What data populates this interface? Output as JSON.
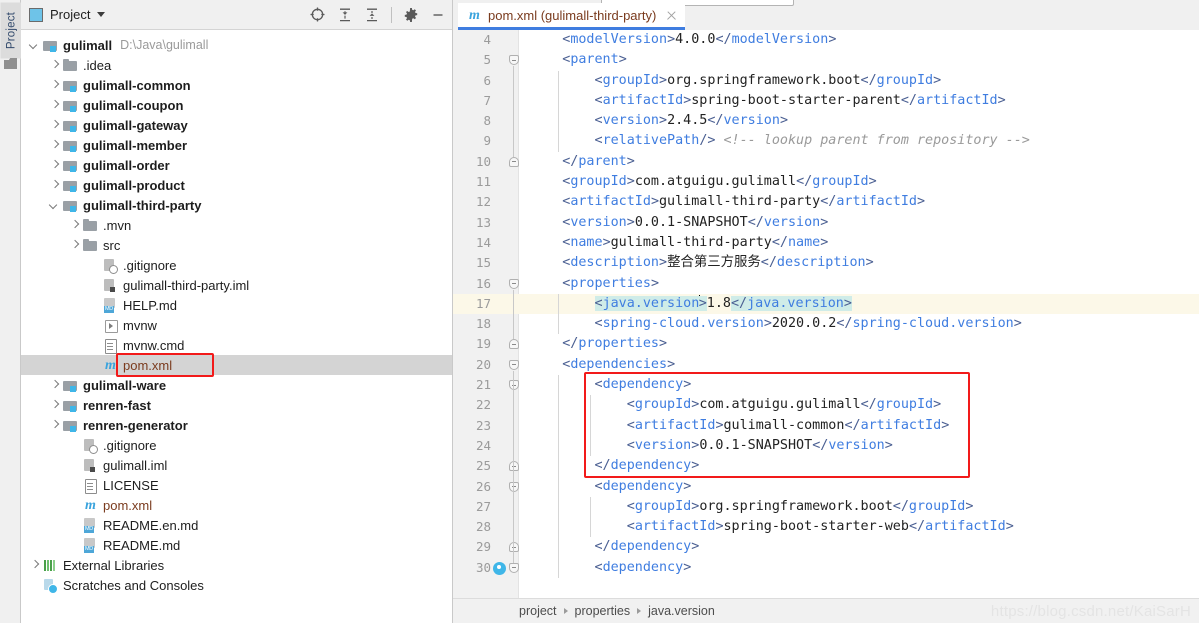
{
  "window": {
    "tool_strip_tab": "Project",
    "tool_strip_icon": "module-icon"
  },
  "project_panel": {
    "title": "Project",
    "title_icon": "project-view-icon",
    "caret_icon": "chevron-down-icon",
    "toolbar": [
      {
        "name": "locate-in-tree-icon",
        "label": "Select Opened File"
      },
      {
        "name": "expand-all-icon",
        "label": "Expand All"
      },
      {
        "name": "collapse-all-icon",
        "label": "Collapse All"
      },
      {
        "name": "gear-icon",
        "label": "Options"
      },
      {
        "name": "minimize-icon",
        "label": "Hide"
      }
    ],
    "tree": [
      {
        "label": "gulimall",
        "path": "D:\\Java\\gulimall",
        "icon": "module-folder-icon",
        "arrow": "down",
        "indent": 0,
        "bold": true
      },
      {
        "label": ".idea",
        "icon": "folder-icon",
        "arrow": "right",
        "indent": 1,
        "bold": false
      },
      {
        "label": "gulimall-common",
        "icon": "module-folder-icon",
        "arrow": "right",
        "indent": 1,
        "bold": true
      },
      {
        "label": "gulimall-coupon",
        "icon": "module-folder-icon",
        "arrow": "right",
        "indent": 1,
        "bold": true
      },
      {
        "label": "gulimall-gateway",
        "icon": "module-folder-icon",
        "arrow": "right",
        "indent": 1,
        "bold": true
      },
      {
        "label": "gulimall-member",
        "icon": "module-folder-icon",
        "arrow": "right",
        "indent": 1,
        "bold": true
      },
      {
        "label": "gulimall-order",
        "icon": "module-folder-icon",
        "arrow": "right",
        "indent": 1,
        "bold": true
      },
      {
        "label": "gulimall-product",
        "icon": "module-folder-icon",
        "arrow": "right",
        "indent": 1,
        "bold": true
      },
      {
        "label": "gulimall-third-party",
        "icon": "module-folder-icon",
        "arrow": "down",
        "indent": 1,
        "bold": true
      },
      {
        "label": ".mvn",
        "icon": "folder-icon",
        "arrow": "right",
        "indent": 2,
        "bold": false
      },
      {
        "label": "src",
        "icon": "folder-icon",
        "arrow": "right",
        "indent": 2,
        "bold": false
      },
      {
        "label": ".gitignore",
        "icon": "gitignore-file-icon",
        "arrow": "none",
        "indent": 3,
        "bold": false
      },
      {
        "label": "gulimall-third-party.iml",
        "icon": "iml-file-icon",
        "arrow": "none",
        "indent": 3,
        "bold": false
      },
      {
        "label": "HELP.md",
        "icon": "markdown-file-icon",
        "arrow": "none",
        "indent": 3,
        "bold": false
      },
      {
        "label": "mvnw",
        "icon": "script-file-icon",
        "arrow": "none",
        "indent": 3,
        "bold": false
      },
      {
        "label": "mvnw.cmd",
        "icon": "text-file-icon",
        "arrow": "none",
        "indent": 3,
        "bold": false
      },
      {
        "label": "pom.xml",
        "icon": "maven-file-icon",
        "arrow": "none",
        "indent": 3,
        "bold": false,
        "selected": true,
        "maven": true,
        "annotated": true
      },
      {
        "label": "gulimall-ware",
        "icon": "module-folder-icon",
        "arrow": "right",
        "indent": 1,
        "bold": true
      },
      {
        "label": "renren-fast",
        "icon": "module-folder-icon",
        "arrow": "right",
        "indent": 1,
        "bold": true
      },
      {
        "label": "renren-generator",
        "icon": "module-folder-icon",
        "arrow": "right",
        "indent": 1,
        "bold": true
      },
      {
        "label": ".gitignore",
        "icon": "gitignore-file-icon",
        "arrow": "none",
        "indent": 2,
        "bold": false
      },
      {
        "label": "gulimall.iml",
        "icon": "iml-file-icon",
        "arrow": "none",
        "indent": 2,
        "bold": false
      },
      {
        "label": "LICENSE",
        "icon": "text-file-icon",
        "arrow": "none",
        "indent": 2,
        "bold": false
      },
      {
        "label": "pom.xml",
        "icon": "maven-file-icon",
        "arrow": "none",
        "indent": 2,
        "bold": false,
        "maven": true
      },
      {
        "label": "README.en.md",
        "icon": "markdown-file-icon",
        "arrow": "none",
        "indent": 2,
        "bold": false
      },
      {
        "label": "README.md",
        "icon": "markdown-file-icon",
        "arrow": "none",
        "indent": 2,
        "bold": false
      },
      {
        "label": "External Libraries",
        "icon": "external-libraries-icon",
        "arrow": "right",
        "indent": 0,
        "bold": false
      },
      {
        "label": "Scratches and Consoles",
        "icon": "scratches-icon",
        "arrow": "none",
        "indent": 0,
        "bold": false
      }
    ]
  },
  "editor": {
    "tab": {
      "label": "pom.xml (gulimall-third-party)",
      "icon": "maven-file-icon",
      "close_icon": "close-icon"
    },
    "first_line_number": 4,
    "lines": [
      {
        "n": 4,
        "indent": 1,
        "fold": "none"
      },
      {
        "n": 5,
        "indent": 1,
        "fold": "open"
      },
      {
        "n": 6,
        "indent": 2,
        "fold": "none"
      },
      {
        "n": 7,
        "indent": 2,
        "fold": "none"
      },
      {
        "n": 8,
        "indent": 2,
        "fold": "none"
      },
      {
        "n": 9,
        "indent": 2,
        "fold": "none"
      },
      {
        "n": 10,
        "indent": 1,
        "fold": "close"
      },
      {
        "n": 11,
        "indent": 1,
        "fold": "none"
      },
      {
        "n": 12,
        "indent": 1,
        "fold": "none"
      },
      {
        "n": 13,
        "indent": 1,
        "fold": "none"
      },
      {
        "n": 14,
        "indent": 1,
        "fold": "none"
      },
      {
        "n": 15,
        "indent": 1,
        "fold": "none"
      },
      {
        "n": 16,
        "indent": 1,
        "fold": "open"
      },
      {
        "n": 17,
        "indent": 2,
        "fold": "none",
        "highlight": true
      },
      {
        "n": 18,
        "indent": 2,
        "fold": "none"
      },
      {
        "n": 19,
        "indent": 1,
        "fold": "close"
      },
      {
        "n": 20,
        "indent": 1,
        "fold": "open"
      },
      {
        "n": 21,
        "indent": 2,
        "fold": "open"
      },
      {
        "n": 22,
        "indent": 3,
        "fold": "none"
      },
      {
        "n": 23,
        "indent": 3,
        "fold": "none"
      },
      {
        "n": 24,
        "indent": 3,
        "fold": "none"
      },
      {
        "n": 25,
        "indent": 2,
        "fold": "close"
      },
      {
        "n": 26,
        "indent": 2,
        "fold": "open"
      },
      {
        "n": 27,
        "indent": 3,
        "fold": "none"
      },
      {
        "n": 28,
        "indent": 3,
        "fold": "none"
      },
      {
        "n": 29,
        "indent": 2,
        "fold": "close"
      },
      {
        "n": 30,
        "indent": 2,
        "fold": "open",
        "bookmark": true
      }
    ],
    "code_text": [
      "    <modelVersion>4.0.0</modelVersion>",
      "    <parent>",
      "        <groupId>org.springframework.boot</groupId>",
      "        <artifactId>spring-boot-starter-parent</artifactId>",
      "        <version>2.4.5</version>",
      "        <relativePath/> <!-- lookup parent from repository -->",
      "    </parent>",
      "    <groupId>com.atguigu.gulimall</groupId>",
      "    <artifactId>gulimall-third-party</artifactId>",
      "    <version>0.0.1-SNAPSHOT</version>",
      "    <name>gulimall-third-party</name>",
      "    <description>整合第三方服务</description>",
      "    <properties>",
      "        <java.version>1.8</java.version>",
      "        <spring-cloud.version>2020.0.2</spring-cloud.version>",
      "    </properties>",
      "    <dependencies>",
      "        <dependency>",
      "            <groupId>com.atguigu.gulimall</groupId>",
      "            <artifactId>gulimall-common</artifactId>",
      "            <version>0.0.1-SNAPSHOT</version>",
      "        </dependency>",
      "        <dependency>",
      "            <groupId>org.springframework.boot</groupId>",
      "            <artifactId>spring-boot-starter-web</artifactId>",
      "        </dependency>",
      "        <dependency>"
    ],
    "caret_line": 17,
    "caret_column_text": "java.version",
    "annotation_box": {
      "color": "#f21a1a",
      "first_line": 21,
      "last_line": 25
    }
  },
  "breadcrumb": {
    "items": [
      "project",
      "properties",
      "java.version"
    ],
    "separator_icon": "chevron-right-icon"
  },
  "watermark": "https://blog.csdn.net/KaiSarH",
  "colors": {
    "accent": "#3f7de0",
    "annotation": "#f21a1a",
    "tag": "#3f7de0",
    "bracket": "#4a5f92",
    "text": "#222222",
    "comment": "#9a9a9a",
    "line_highlight": "#fcf8e8",
    "selection": "#cfece8"
  }
}
